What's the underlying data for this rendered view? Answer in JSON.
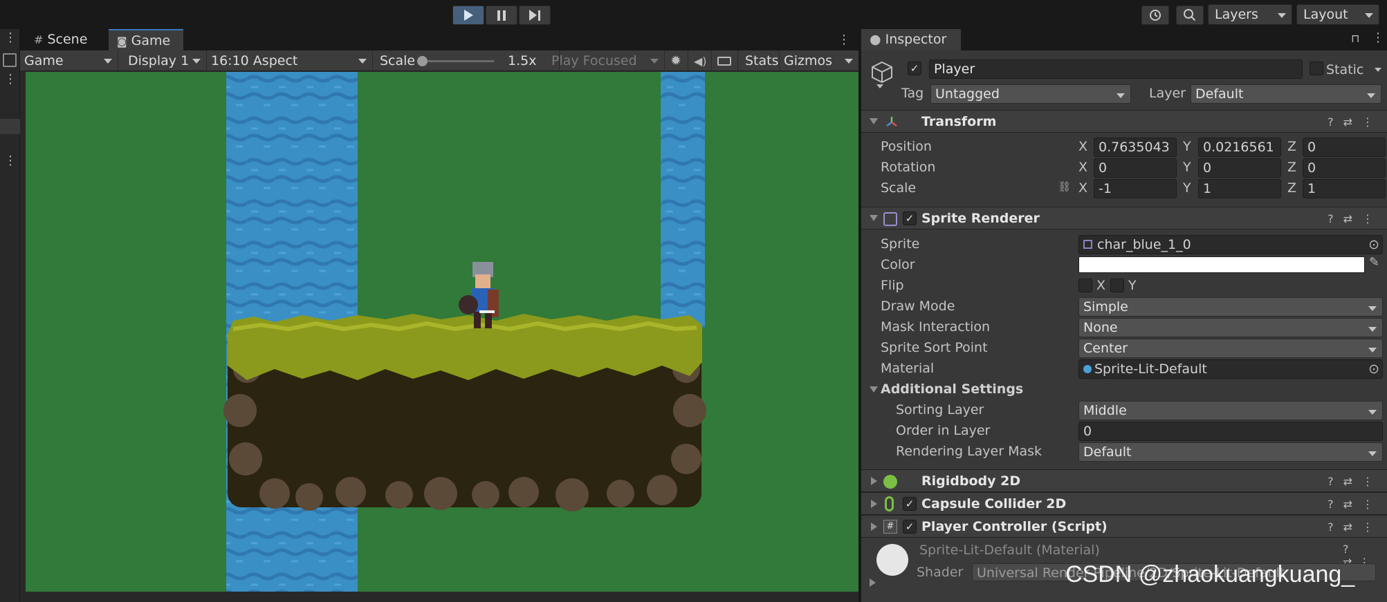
{
  "toolbar": {
    "play_icon": "play-icon",
    "pause_icon": "pause-icon",
    "step_icon": "step-icon",
    "layers_label": "Layers",
    "layout_label": "Layout"
  },
  "game": {
    "tabs": [
      {
        "label": "Scene",
        "icon": "grid-icon"
      },
      {
        "label": "Game",
        "icon": "gamepad-icon"
      }
    ],
    "toolbar": {
      "mode": "Game",
      "display": "Display 1",
      "aspect": "16:10 Aspect",
      "scale_label": "Scale",
      "scale_value": "1.5x",
      "scale_fraction": 0.0,
      "play_focused": "Play Focused",
      "stats": "Stats",
      "gizmos": "Gizmos"
    }
  },
  "inspector": {
    "tab": "Inspector",
    "object": {
      "name": "Player",
      "active": true,
      "static_label": "Static",
      "tag_label": "Tag",
      "tag_value": "Untagged",
      "layer_label": "Layer",
      "layer_value": "Default"
    },
    "transform": {
      "title": "Transform",
      "rows": [
        {
          "label": "Position",
          "x": "0.7635043",
          "y": "0.0216561",
          "z": "0"
        },
        {
          "label": "Rotation",
          "x": "0",
          "y": "0",
          "z": "0"
        },
        {
          "label": "Scale",
          "x": "-1",
          "y": "1",
          "z": "1"
        }
      ]
    },
    "sprite_renderer": {
      "title": "Sprite Renderer",
      "enabled": true,
      "sprite_label": "Sprite",
      "sprite_value": "char_blue_1_0",
      "color_label": "Color",
      "color_value": "#ffffff",
      "flip_label": "Flip",
      "flip_x": "X",
      "flip_y": "Y",
      "draw_mode_label": "Draw Mode",
      "draw_mode_value": "Simple",
      "mask_label": "Mask Interaction",
      "mask_value": "None",
      "sort_point_label": "Sprite Sort Point",
      "sort_point_value": "Center",
      "material_label": "Material",
      "material_value": "Sprite-Lit-Default",
      "additional_label": "Additional Settings",
      "sorting_layer_label": "Sorting Layer",
      "sorting_layer_value": "Middle",
      "order_label": "Order in Layer",
      "order_value": "0",
      "rendering_mask_label": "Rendering Layer Mask",
      "rendering_mask_value": "Default"
    },
    "components": [
      {
        "title": "Rigidbody 2D",
        "has_toggle": false
      },
      {
        "title": "Capsule Collider 2D",
        "has_toggle": true
      },
      {
        "title": "Player Controller (Script)",
        "has_toggle": true
      }
    ],
    "material": {
      "title": "Sprite-Lit-Default (Material)",
      "shader_label": "Shader",
      "shader_value": "Universal Render Pipeline/2D/Sprite-Lit-Default"
    }
  },
  "watermark": "CSDN @zhaokuangkuang_"
}
